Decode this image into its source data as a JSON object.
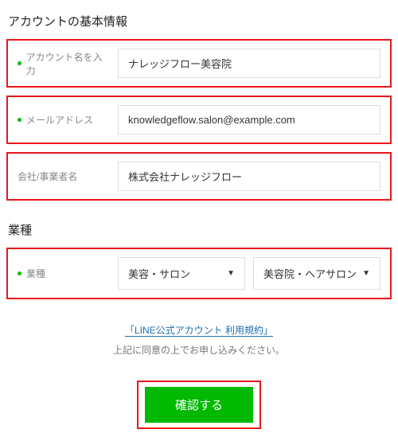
{
  "section1": {
    "title": "アカウントの基本情報"
  },
  "account_name": {
    "label": "アカウント名を入力",
    "value": "ナレッジフロー美容院"
  },
  "email": {
    "label": "メールアドレス",
    "value": "knowledgeflow.salon@example.com"
  },
  "company": {
    "label": "会社/事業者名",
    "value": "株式会社ナレッジフロー"
  },
  "section2": {
    "title": "業種"
  },
  "industry": {
    "label": "業種",
    "major": "美容・サロン",
    "minor": "美容院・ヘアサロン"
  },
  "terms": {
    "link": "「LINE公式アカウント 利用規約」",
    "note": "上記に同意の上でお申し込みください。"
  },
  "submit": {
    "label": "確認する"
  }
}
